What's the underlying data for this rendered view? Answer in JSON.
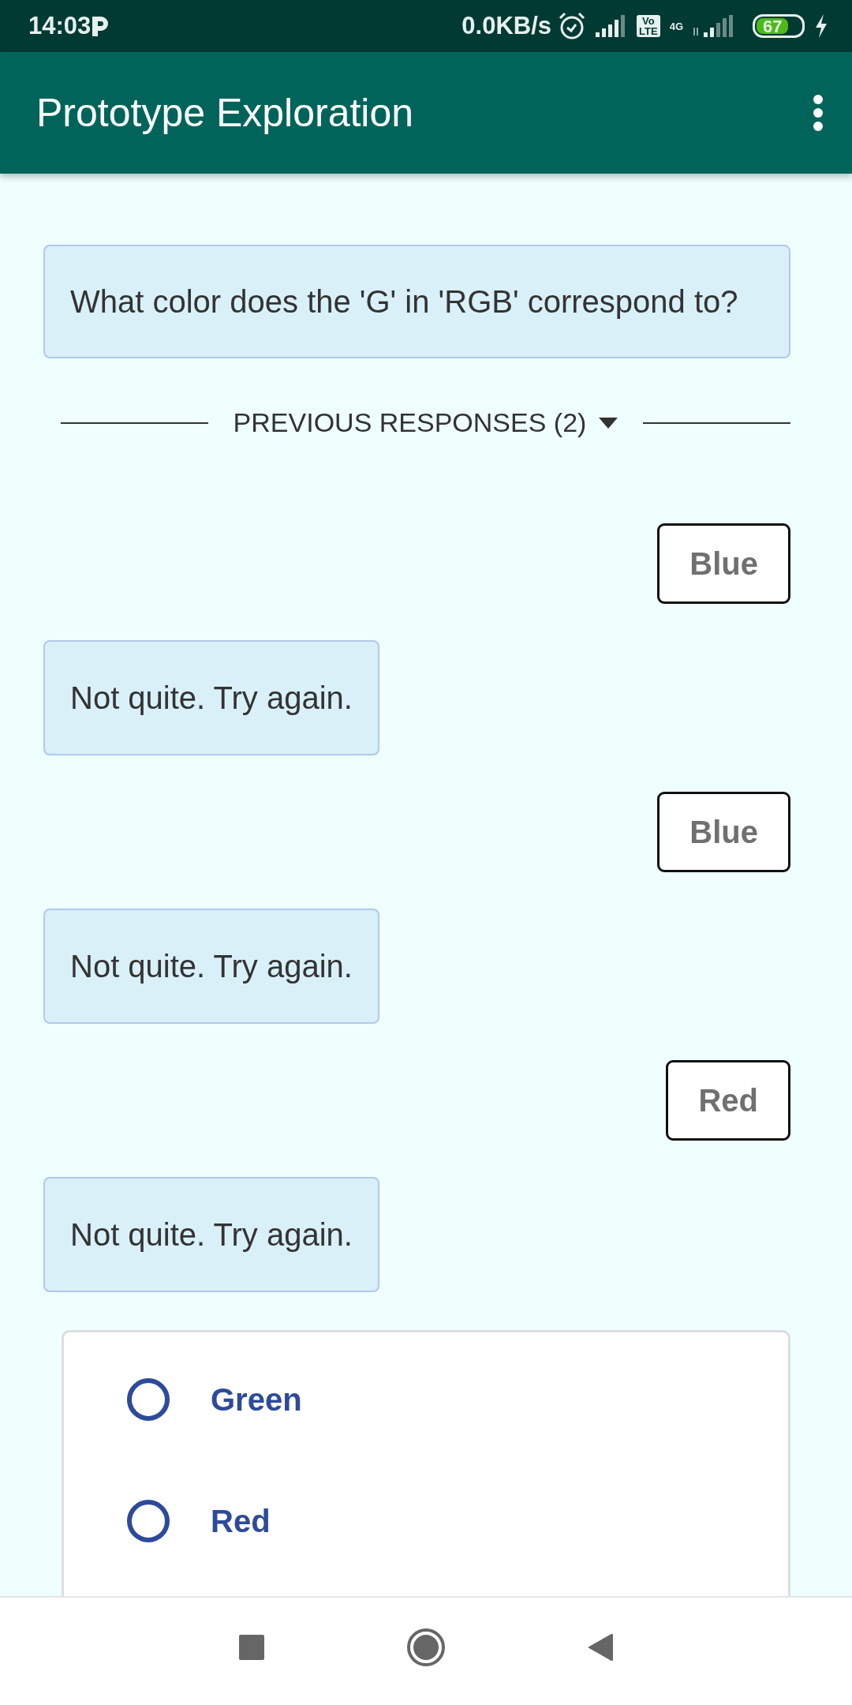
{
  "status_bar": {
    "time": "14:03",
    "network_speed": "0.0KB/s",
    "volte": [
      "Vo",
      "LTE"
    ],
    "network_type": "4G",
    "battery": "67"
  },
  "app_bar": {
    "title": "Prototype Exploration"
  },
  "question": "What color does the 'G' in 'RGB' correspond to?",
  "previous_responses": {
    "label": "PREVIOUS RESPONSES (2)"
  },
  "messages": [
    {
      "kind": "answer",
      "text": "Blue"
    },
    {
      "kind": "feedback",
      "text": "Not quite. Try again."
    },
    {
      "kind": "answer",
      "text": "Blue"
    },
    {
      "kind": "feedback",
      "text": "Not quite. Try again."
    },
    {
      "kind": "answer",
      "text": "Red"
    },
    {
      "kind": "feedback",
      "text": "Not quite. Try again."
    }
  ],
  "choices": [
    {
      "label": "Green",
      "selected": false
    },
    {
      "label": "Red",
      "selected": false
    }
  ]
}
